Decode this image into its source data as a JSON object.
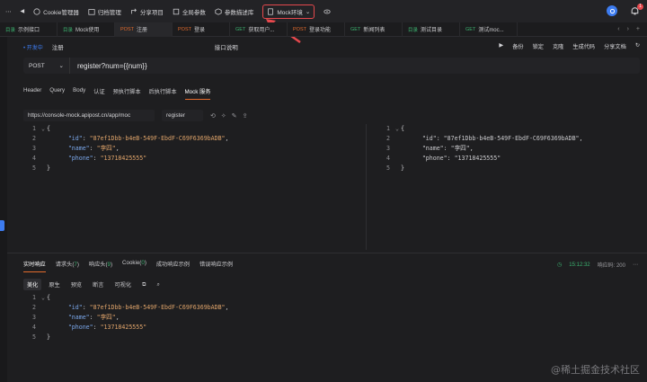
{
  "toolbar": {
    "items": [
      {
        "icon": "dots-icon",
        "label": "⋯"
      },
      {
        "icon": "back-arrow-icon",
        "label": "◀"
      },
      {
        "icon": "cookie-icon",
        "label": "Cookie管理器"
      },
      {
        "icon": "archive-icon",
        "label": "归档管理"
      },
      {
        "icon": "share-icon",
        "label": "分享项目"
      },
      {
        "icon": "params-icon",
        "label": "全局参数"
      },
      {
        "icon": "cube-icon",
        "label": "参数描述库"
      }
    ],
    "mock_env": "Mock环境",
    "badge_count": "1"
  },
  "tabs": [
    {
      "method": "目录",
      "label": "示例接口",
      "method_color": "#3bb16f"
    },
    {
      "method": "目录",
      "label": "Mock使用",
      "method_color": "#3bb16f"
    },
    {
      "method": "POST",
      "label": "注册",
      "method_color": "#e36b2c",
      "active": true
    },
    {
      "method": "POST",
      "label": "登录",
      "method_color": "#e36b2c"
    },
    {
      "method": "GET",
      "label": "获取用户...",
      "method_color": "#3bb16f"
    },
    {
      "method": "POST",
      "label": "登录功能",
      "method_color": "#e36b2c"
    },
    {
      "method": "GET",
      "label": "新闻列表",
      "method_color": "#3bb16f"
    },
    {
      "method": "目录",
      "label": "测试目录",
      "method_color": "#3bb16f"
    },
    {
      "method": "GET",
      "label": "测试moc...",
      "method_color": "#3bb16f"
    }
  ],
  "status": {
    "pill": "• 开发中",
    "name": "注册",
    "save_label": "接口说明"
  },
  "actions": [
    "▶",
    "备份",
    "锁定",
    "克隆",
    "生成代码",
    "分享文档",
    "↻"
  ],
  "request": {
    "method": "POST",
    "url": "register?num={{num}}"
  },
  "subtabs": [
    "Header",
    "Query",
    "Body",
    "认证",
    "预执行脚本",
    "后执行脚本",
    "Mock 服务"
  ],
  "mock": {
    "url": "https://console-mock.apipost.cn/app/moc",
    "name": "register"
  },
  "code": {
    "lines": [
      {
        "n": "1",
        "text": "{"
      },
      {
        "n": "2",
        "key": "\"id\"",
        "val": "\"87ef1Dbb-b4eB-549F-EbdF-C69F6369bADB\""
      },
      {
        "n": "3",
        "key": "\"name\"",
        "val": "\"李四\""
      },
      {
        "n": "4",
        "key": "\"phone\"",
        "val": "\"13718425555\""
      },
      {
        "n": "5",
        "text": "}"
      }
    ]
  },
  "response_tabs": [
    {
      "label": "实时响应",
      "active": true
    },
    {
      "label": "请求头",
      "count": "7"
    },
    {
      "label": "响应头",
      "count": "9"
    },
    {
      "label": "Cookie",
      "count": "0"
    },
    {
      "label": "成功响应示例"
    },
    {
      "label": "错误响应示例"
    }
  ],
  "response_meta": {
    "time": "15:12:32",
    "status_label": "响应码: 200"
  },
  "view_buttons": [
    "美化",
    "原生",
    "预览",
    "断言",
    "可视化"
  ],
  "watermark": "@稀土掘金技术社区"
}
